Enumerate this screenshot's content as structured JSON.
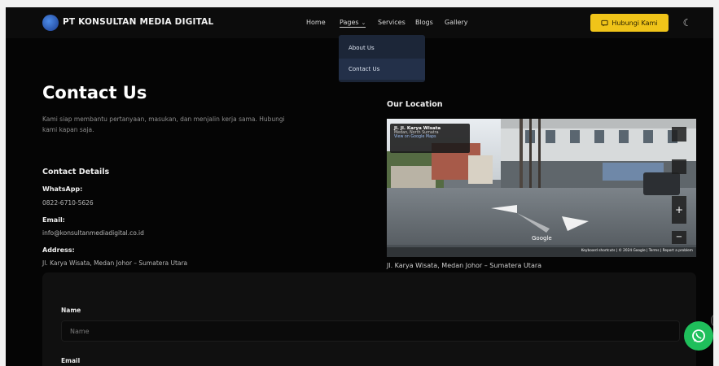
{
  "header": {
    "brand": "PT KONSULTAN MEDIA DIGITAL",
    "nav": [
      {
        "label": "Home"
      },
      {
        "label": "Pages"
      },
      {
        "label": "Services"
      },
      {
        "label": "Blogs"
      },
      {
        "label": "Gallery"
      }
    ],
    "cta_label": "Hubungi Kami",
    "dropdown": [
      {
        "label": "About Us"
      },
      {
        "label": "Contact Us"
      }
    ]
  },
  "contact": {
    "title": "Contact Us",
    "intro": "Kami siap membantu pertanyaan, masukan, dan menjalin kerja sama. Hubungi kami kapan saja.",
    "details_title": "Contact Details",
    "whatsapp_label": "WhatsApp:",
    "whatsapp_value": "0822-6710-5626",
    "email_label": "Email:",
    "email_value": "info@konsultanmediadigital.co.id",
    "address_label": "Address:",
    "address_value": "Jl. Karya Wisata, Medan Johor – Sumatera Utara"
  },
  "location": {
    "title": "Our Location",
    "card_title": "Jl. Jl. Karya Wisata",
    "card_lines": [
      "Medan, North Sumatra",
      "View on Google Maps"
    ],
    "watermark": "Google",
    "attribution": "Keyboard shortcuts | © 2024 Google | Terms | Report a problem",
    "address_caption": "Jl. Karya Wisata, Medan Johor – Sumatera Utara"
  },
  "form": {
    "name_label": "Name",
    "name_placeholder": "Name",
    "email_label": "Email"
  },
  "colors": {
    "accent": "#f0c419",
    "background": "#050505",
    "whatsapp": "#1fbf5b",
    "dropdown": "#1c2638"
  }
}
